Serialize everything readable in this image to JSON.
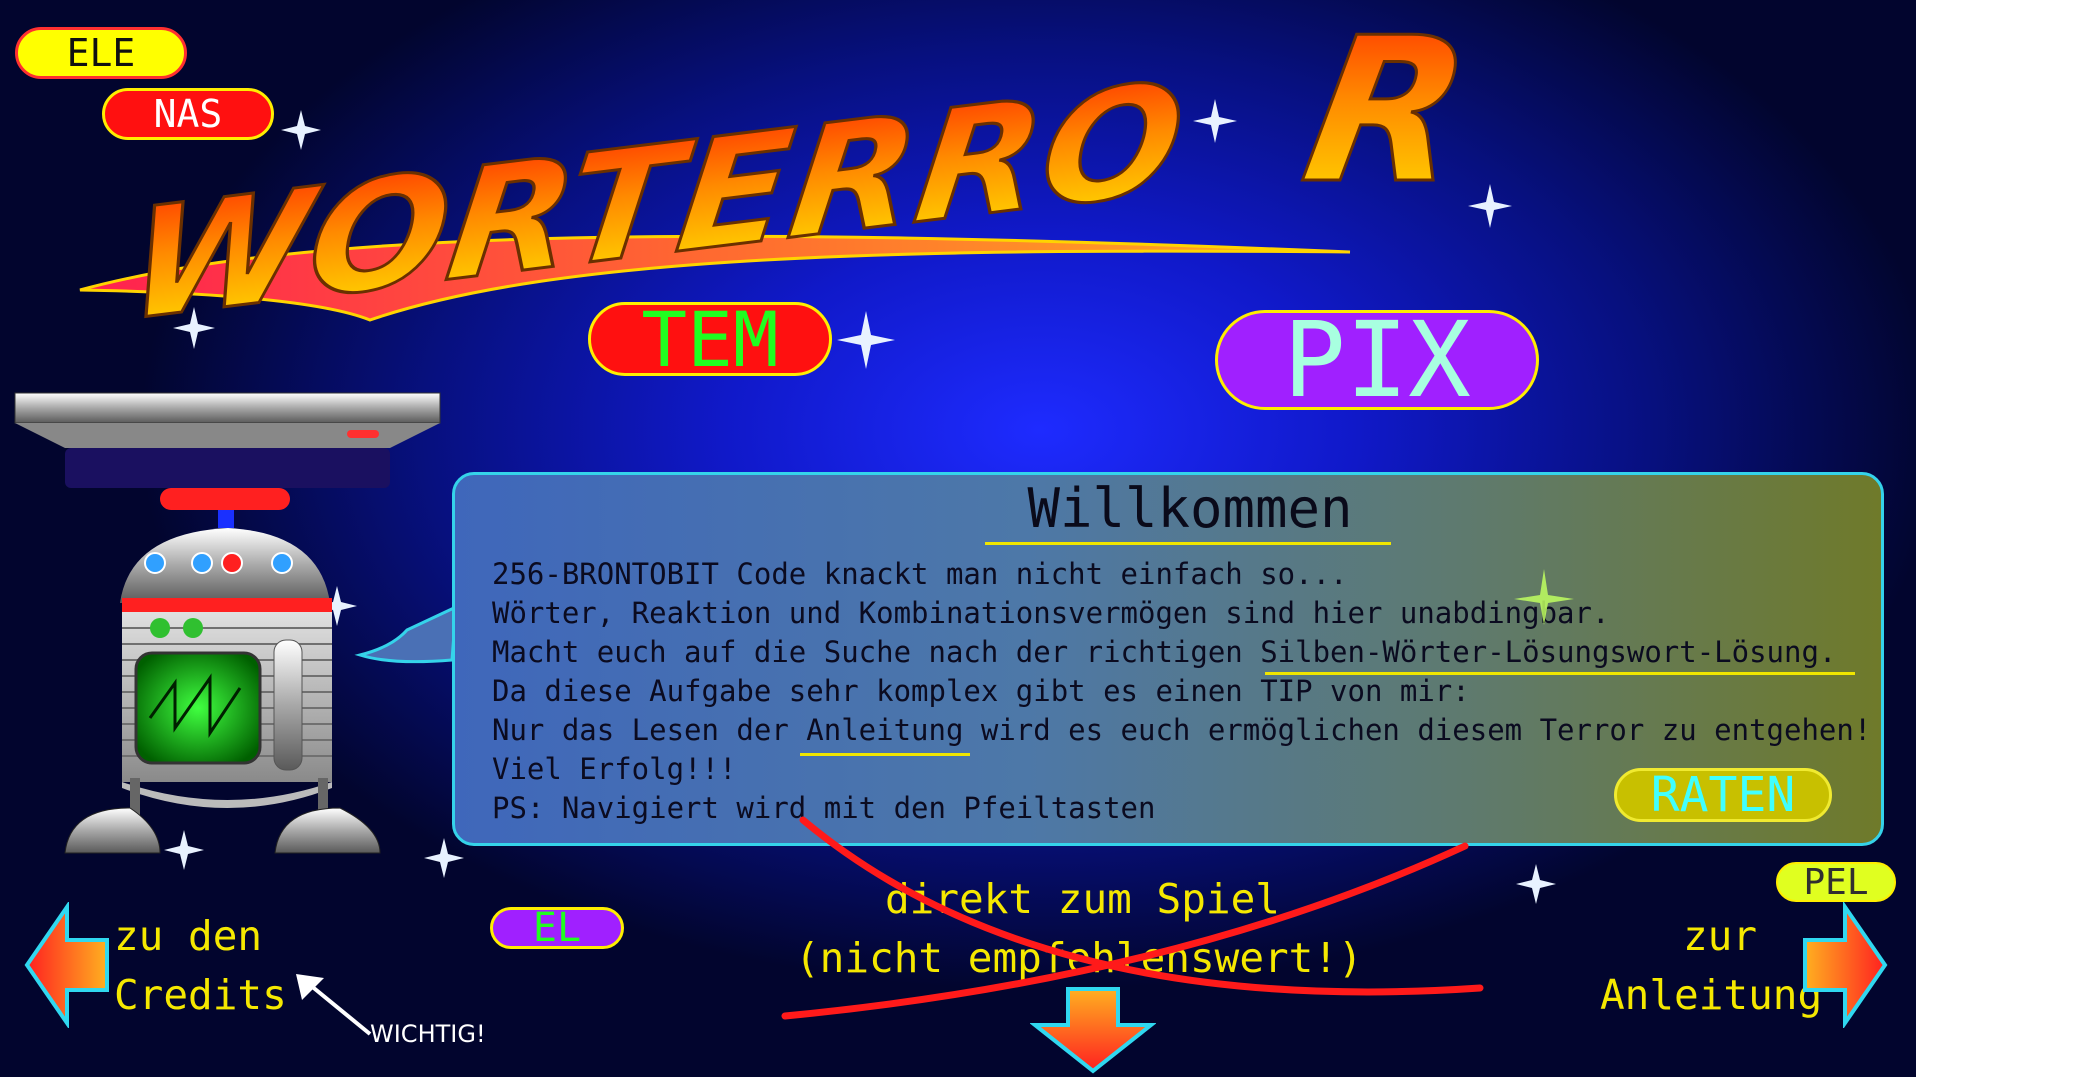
{
  "colors": {
    "background_center": "#1e2bff",
    "background_edge": "#02052e",
    "nav_text": "#f5e800",
    "bubble_border": "#35d3ea",
    "strike": "#ff2020"
  },
  "logo": {
    "text_part": "WORTERRO",
    "big_letter": "R"
  },
  "badges": {
    "ele": "ELE",
    "nas": "NAS",
    "tem": "TEM",
    "pix": "PIX",
    "el": "EL",
    "pel": "PEL"
  },
  "welcome": {
    "title": "Willkommen",
    "lines": [
      "256-BRONTOBIT Code knackt man nicht einfach so...",
      "Wörter, Reaktion und Kombinationsvermögen sind hier unabdingbar.",
      "Macht euch auf die Suche nach der richtigen Silben-Wörter-Lösungswort-Lösung.",
      "Da diese Aufgabe sehr komplex gibt es einen TIP von mir:",
      "Nur das Lesen der Anleitung wird es euch ermöglichen diesem Terror zu entgehen!",
      "Viel Erfolg!!!",
      "PS: Navigiert wird mit den Pfeiltasten"
    ],
    "raten_button": "RATEN"
  },
  "nav": {
    "credits": {
      "line1": "zu den",
      "line2": "Credits"
    },
    "direct_play": {
      "line1": "direkt zum Spiel",
      "line2": "(nicht empfehlenswert!)"
    },
    "manual": {
      "line1": "zur",
      "line2": "Anleitung"
    },
    "note": "WICHTIG!"
  },
  "icons": {
    "left_arrow": "arrow-left-icon",
    "right_arrow": "arrow-right-icon",
    "down_arrow": "arrow-down-icon",
    "pointer": "pointer-arrow-icon",
    "robot": "robot-icon",
    "sparkle": "sparkle-icon"
  }
}
